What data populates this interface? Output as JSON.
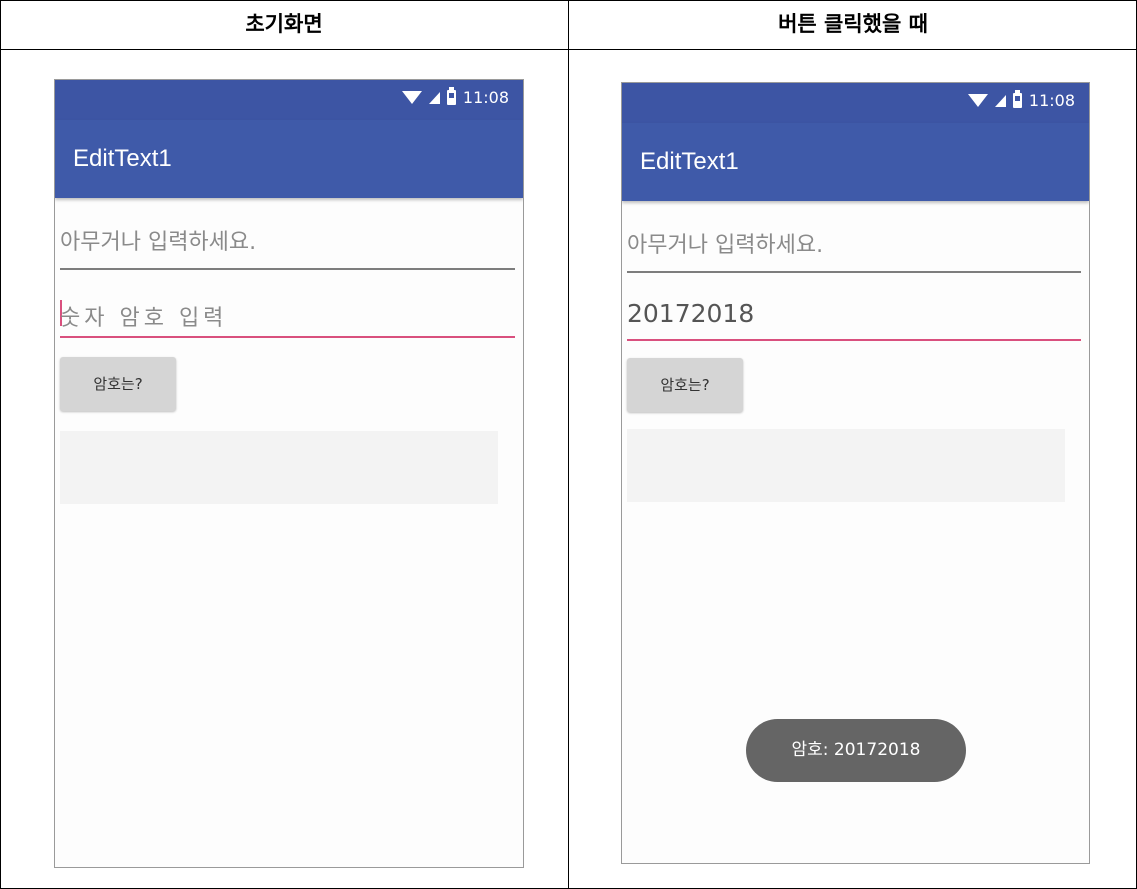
{
  "headers": {
    "left": "초기화면",
    "right": "버튼 클릭했을 때"
  },
  "status_bar": {
    "time": "11:08",
    "icons": [
      "wifi-icon",
      "signal-icon",
      "battery-icon"
    ]
  },
  "app": {
    "title": "EditText1"
  },
  "screens": {
    "initial": {
      "edit1_hint": "아무거나 입력하세요.",
      "edit2_hint": "숫자 암호 입력",
      "button_label": "암호는?"
    },
    "clicked": {
      "edit1_hint": "아무거나 입력하세요.",
      "edit2_value": "20172018",
      "button_label": "암호는?",
      "toast": "암호: 20172018"
    }
  },
  "colors": {
    "primary": "#3f5aa9",
    "status_bar": "#3d55a4",
    "accent": "#d9507e",
    "button": "#d5d5d5",
    "toast": "#656565"
  }
}
